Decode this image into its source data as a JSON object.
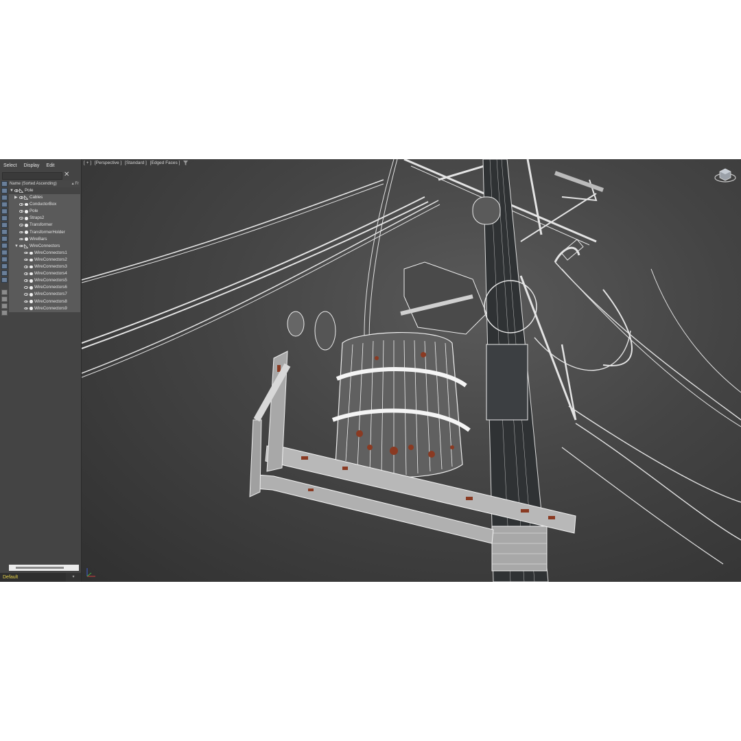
{
  "explorer": {
    "menu": [
      "Select",
      "Display",
      "Edit"
    ],
    "column_header": "Name (Sorted Ascending)",
    "column_header_right": "▴ Fr",
    "items": [
      {
        "label": "Pole",
        "level": 0,
        "expand": "open",
        "type": "bone"
      },
      {
        "label": "Cables",
        "level": 1,
        "expand": "closed",
        "type": "bone",
        "selected": true
      },
      {
        "label": "ConductorBox",
        "level": 1,
        "expand": "none",
        "type": "object",
        "selected": true
      },
      {
        "label": "Pole",
        "level": 1,
        "expand": "none",
        "type": "object",
        "selected": true
      },
      {
        "label": "Straps2",
        "level": 1,
        "expand": "none",
        "type": "object",
        "selected": true
      },
      {
        "label": "Transformer",
        "level": 1,
        "expand": "none",
        "type": "object",
        "selected": true
      },
      {
        "label": "TransformerHolder",
        "level": 1,
        "expand": "none",
        "type": "object",
        "selected": true
      },
      {
        "label": "WireBars",
        "level": 1,
        "expand": "none",
        "type": "object",
        "selected": true
      },
      {
        "label": "WireConnectors",
        "level": 1,
        "expand": "open",
        "type": "bone",
        "selected": true
      },
      {
        "label": "WireConnectors1",
        "level": 2,
        "expand": "none",
        "type": "object",
        "selected": true
      },
      {
        "label": "WireConnectors2",
        "level": 2,
        "expand": "none",
        "type": "object",
        "selected": true
      },
      {
        "label": "WireConnectors3",
        "level": 2,
        "expand": "none",
        "type": "object",
        "selected": true
      },
      {
        "label": "WireConnectors4",
        "level": 2,
        "expand": "none",
        "type": "object",
        "selected": true
      },
      {
        "label": "WireConnectors5",
        "level": 2,
        "expand": "none",
        "type": "object",
        "selected": true
      },
      {
        "label": "WireConnectors6",
        "level": 2,
        "expand": "none",
        "type": "object",
        "selected": true
      },
      {
        "label": "WireConnectors7",
        "level": 2,
        "expand": "none",
        "type": "object",
        "selected": true
      },
      {
        "label": "WireConnectors8",
        "level": 2,
        "expand": "none",
        "type": "object",
        "selected": true
      },
      {
        "label": "WireConnectors9",
        "level": 2,
        "expand": "none",
        "type": "object",
        "selected": true
      }
    ],
    "toolbar_icons": [
      "display-none-icon",
      "display-all-icon",
      "display-invert-icon",
      "geometry-icon",
      "shape-icon",
      "light-icon",
      "camera-icon",
      "helper-icon",
      "spacewarp-icon",
      "group-icon",
      "xref-icon",
      "bone-icon",
      "container-icon",
      "frozen-icon",
      "hidden-icon",
      "layer-icon",
      "filter-icon",
      "funnel-icon",
      "tab-icon"
    ],
    "layer": "Default"
  },
  "viewport": {
    "labels": [
      "[ + ]",
      "[Perspective ]",
      "[Standard ]",
      "[Edged Faces ]"
    ],
    "filter_icon": "funnel-icon",
    "navigation_icon": "viewcube-icon",
    "axis_icon": "xyz-axis-icon"
  },
  "colors": {
    "panel_bg": "#444444",
    "viewport_bg": "#3a3a3a",
    "selection_bg": "#5a5a5a",
    "layer_text": "#e8d44a",
    "wire": "#e6e6e6",
    "rust": "#8a3a22"
  }
}
